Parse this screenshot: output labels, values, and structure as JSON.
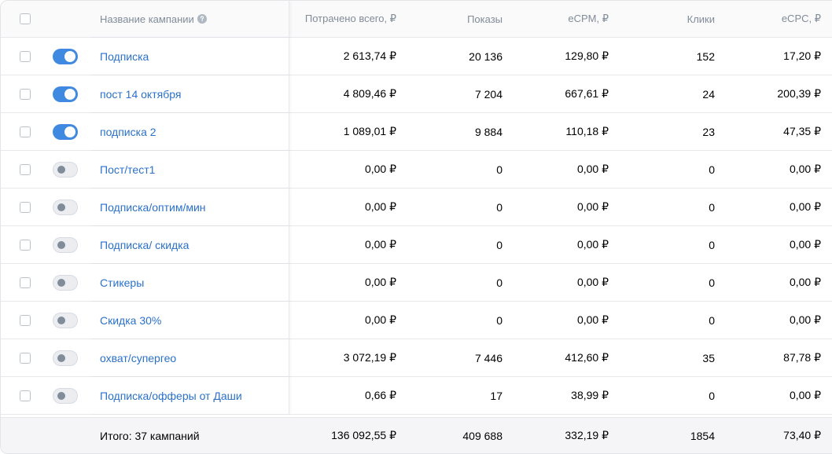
{
  "header": {
    "name": "Название кампании",
    "help_icon": "question-circle-icon",
    "spent": "Потрачено всего, ₽",
    "impressions": "Показы",
    "ecpm": "eCPM, ₽",
    "clicks": "Клики",
    "ecpc": "eCPC, ₽"
  },
  "rows": [
    {
      "enabled": true,
      "name": "Подписка",
      "spent": "2 613,74 ₽",
      "impressions": "20 136",
      "ecpm": "129,80 ₽",
      "clicks": "152",
      "ecpc": "17,20 ₽"
    },
    {
      "enabled": true,
      "name": "пост 14 октября",
      "spent": "4 809,46 ₽",
      "impressions": "7 204",
      "ecpm": "667,61 ₽",
      "clicks": "24",
      "ecpc": "200,39 ₽"
    },
    {
      "enabled": true,
      "name": "подписка 2",
      "spent": "1 089,01 ₽",
      "impressions": "9 884",
      "ecpm": "110,18 ₽",
      "clicks": "23",
      "ecpc": "47,35 ₽"
    },
    {
      "enabled": false,
      "name": "Пост/тест1",
      "spent": "0,00 ₽",
      "impressions": "0",
      "ecpm": "0,00 ₽",
      "clicks": "0",
      "ecpc": "0,00 ₽"
    },
    {
      "enabled": false,
      "name": "Подписка/оптим/мин",
      "spent": "0,00 ₽",
      "impressions": "0",
      "ecpm": "0,00 ₽",
      "clicks": "0",
      "ecpc": "0,00 ₽"
    },
    {
      "enabled": false,
      "name": "Подписка/ скидка",
      "spent": "0,00 ₽",
      "impressions": "0",
      "ecpm": "0,00 ₽",
      "clicks": "0",
      "ecpc": "0,00 ₽"
    },
    {
      "enabled": false,
      "name": "Стикеры",
      "spent": "0,00 ₽",
      "impressions": "0",
      "ecpm": "0,00 ₽",
      "clicks": "0",
      "ecpc": "0,00 ₽"
    },
    {
      "enabled": false,
      "name": "Скидка 30%",
      "spent": "0,00 ₽",
      "impressions": "0",
      "ecpm": "0,00 ₽",
      "clicks": "0",
      "ecpc": "0,00 ₽"
    },
    {
      "enabled": false,
      "name": "охват/супергео",
      "spent": "3 072,19 ₽",
      "impressions": "7 446",
      "ecpm": "412,60 ₽",
      "clicks": "35",
      "ecpc": "87,78 ₽"
    },
    {
      "enabled": false,
      "name": "Подписка/офферы от Даши",
      "spent": "0,66 ₽",
      "impressions": "17",
      "ecpm": "38,99 ₽",
      "clicks": "0",
      "ecpc": "0,00 ₽"
    }
  ],
  "footer": {
    "label": "Итого: 37 кампаний",
    "spent": "136 092,55 ₽",
    "impressions": "409 688",
    "ecpm": "332,19 ₽",
    "clicks": "1854",
    "ecpc": "73,40 ₽"
  },
  "colors": {
    "link": "#2b71c9",
    "toggle_on": "#3f8ae0",
    "toggle_off_knob": "#818c99",
    "header_text": "#818c99"
  }
}
